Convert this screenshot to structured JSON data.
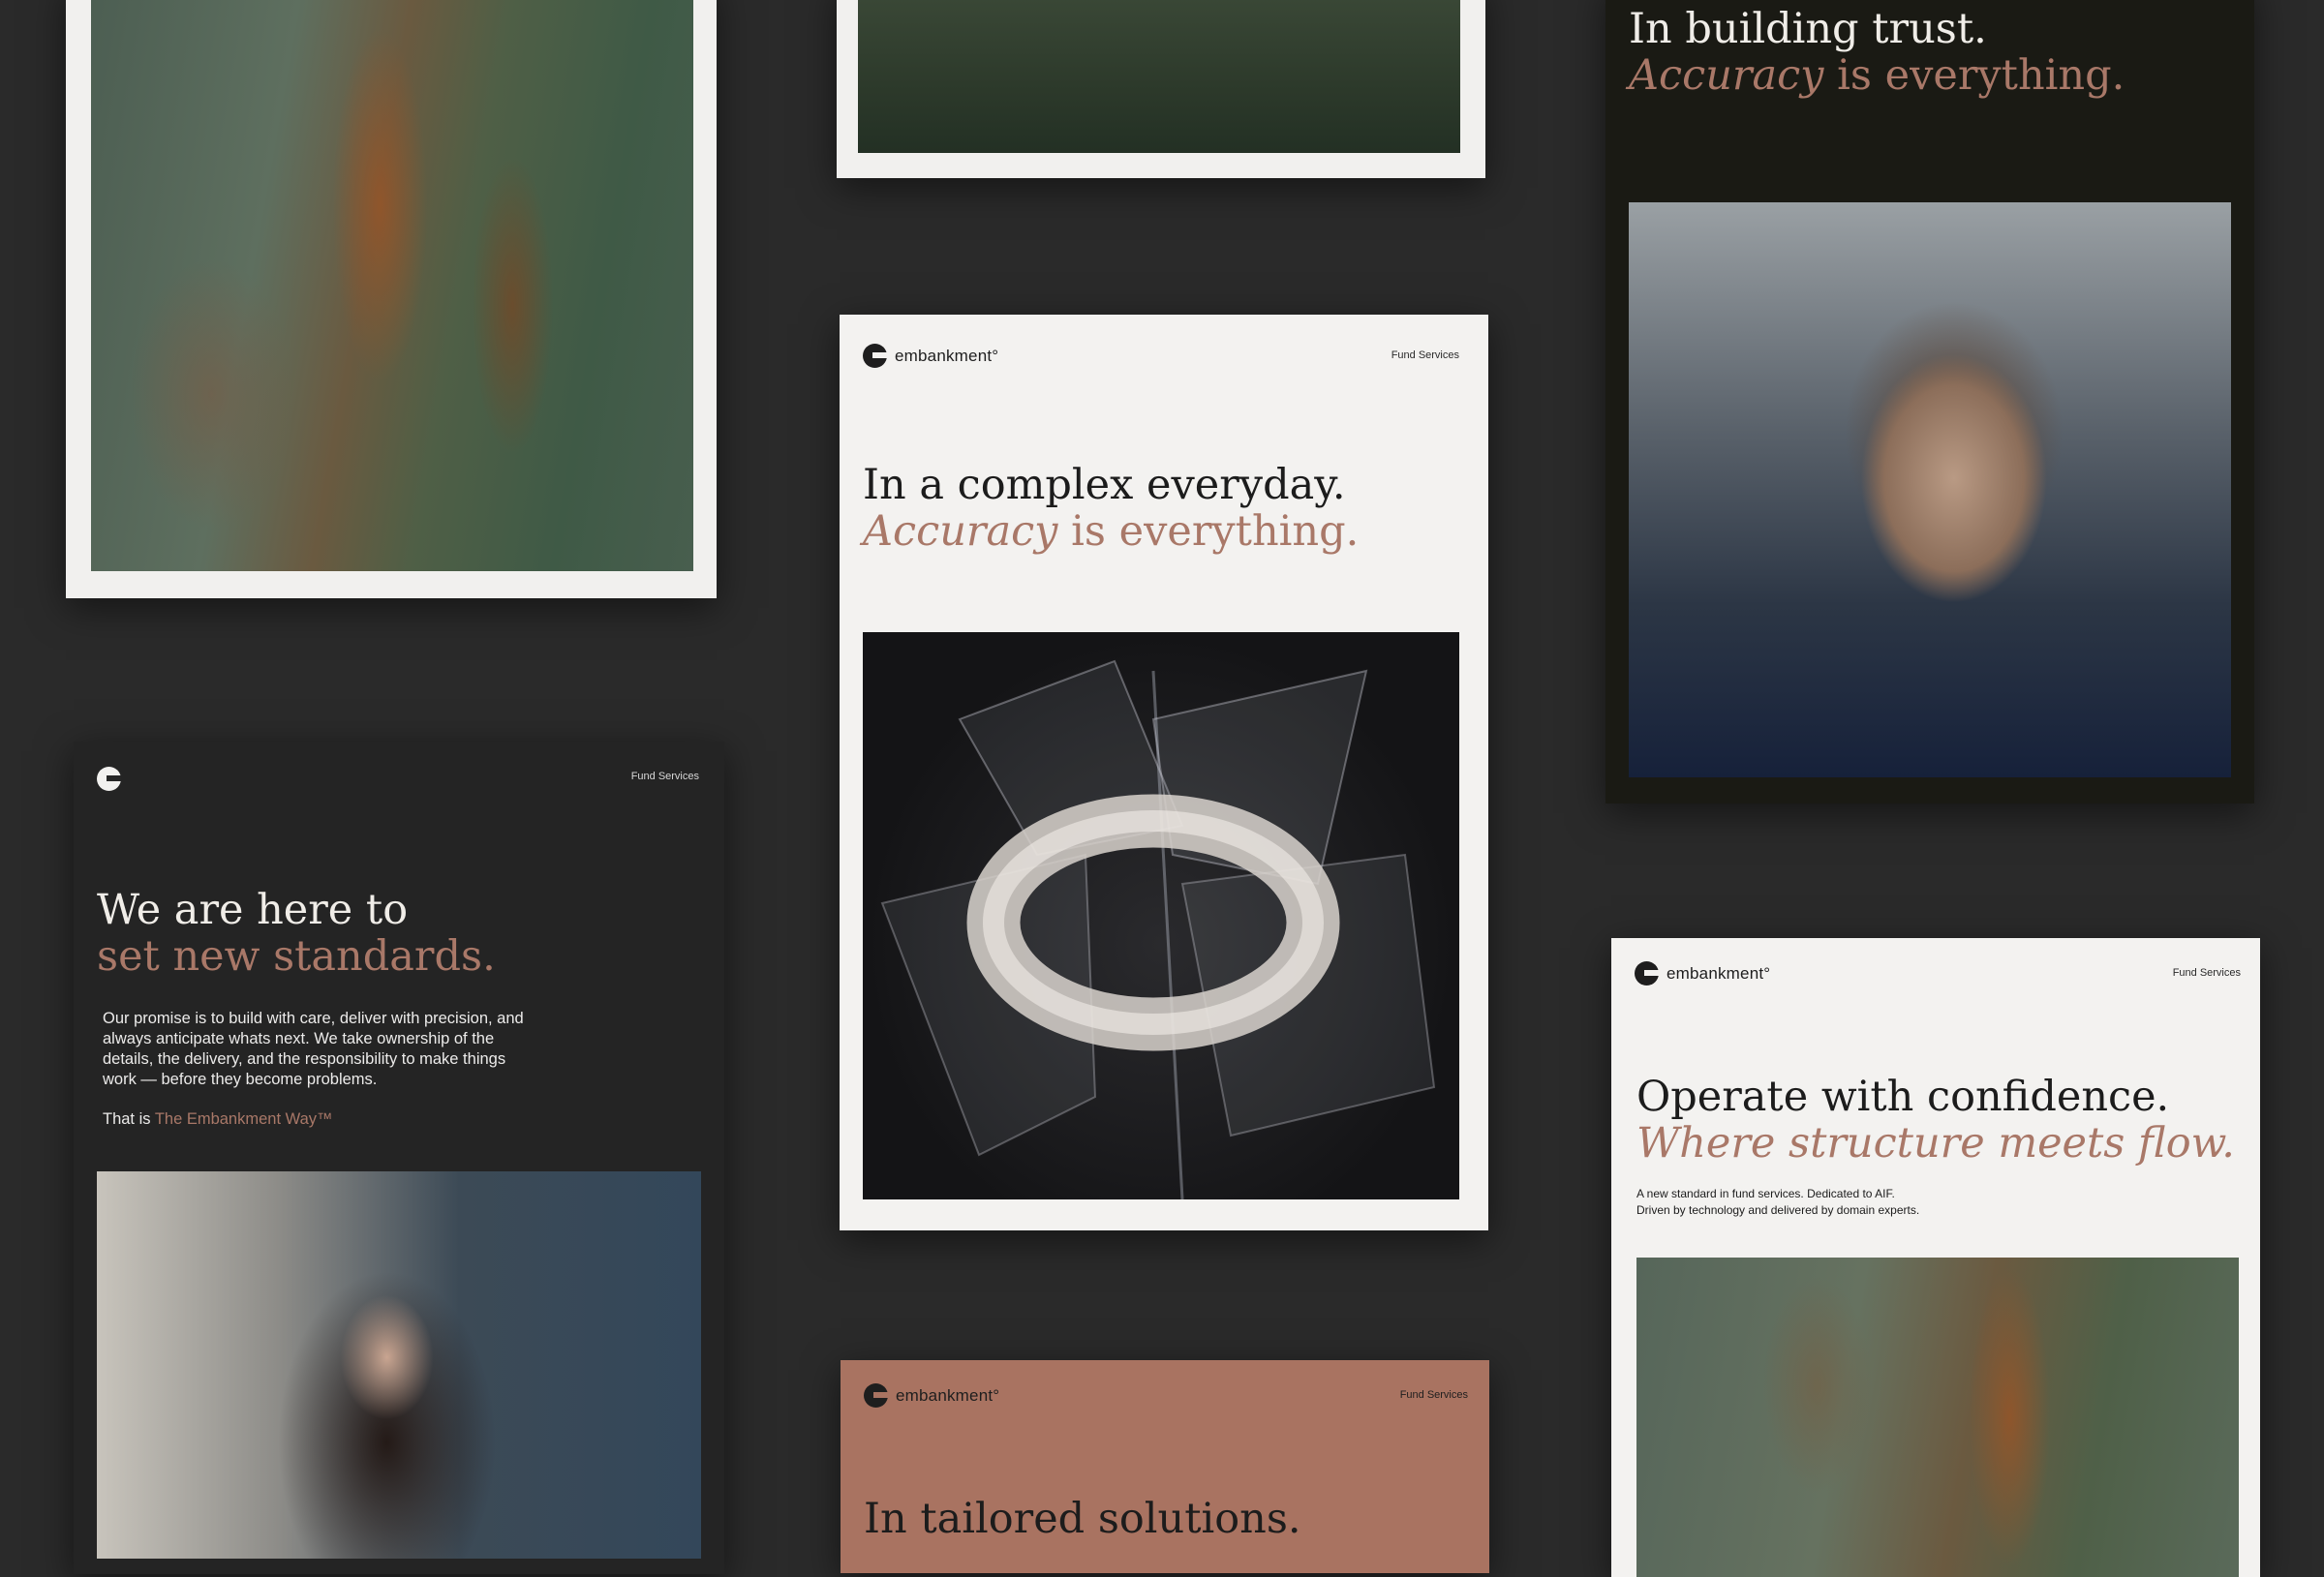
{
  "brand": {
    "name": "embankment°",
    "tag": "Fund Services",
    "accent_color": "#a97868"
  },
  "cards": {
    "landscape_print": {
      "icon": "aerial-landscape-photo"
    },
    "grass_print": {
      "icon": "grass-field-photo"
    },
    "accuracy_poster": {
      "line1": "In a complex everyday.",
      "line2_em": "Accuracy",
      "line2_rest": " is everything.",
      "icon": "glass-torus-render"
    },
    "trust_poster": {
      "line1": "In building trust.",
      "line2_em": "Accuracy",
      "line2_rest": " is everything.",
      "icon": "man-at-desk-photo"
    },
    "standards_poster": {
      "line1": "We are here to",
      "line2": "set new standards.",
      "body": "Our promise is to build with care, deliver with precision, and always anticipate whats next. We take ownership of the details, the delivery, and the responsibility to make things work — before they become problems.",
      "closing_prefix": "That is ",
      "closing_highlight": "The Embankment Way™",
      "icon": "woman-at-desk-photo"
    },
    "tailored_poster": {
      "line1": "In tailored solutions.",
      "background": "#a97361"
    },
    "confidence_poster": {
      "line1": "Operate with confidence.",
      "line2": "Where structure meets flow.",
      "sub1": "A new standard in fund services. Dedicated to AIF.",
      "sub2": "Driven by technology and delivered by domain experts.",
      "icon": "aerial-landscape-photo"
    }
  }
}
